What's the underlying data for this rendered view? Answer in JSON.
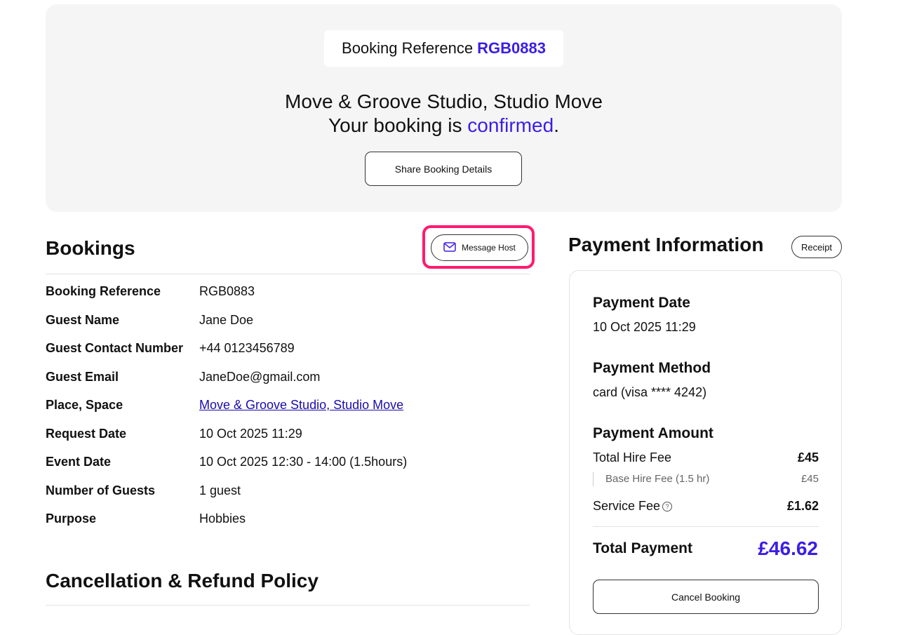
{
  "hero": {
    "ref_label": "Booking Reference",
    "ref_code": "RGB0883",
    "title": "Move & Groove Studio, Studio Move",
    "status_prefix": "Your booking is",
    "status_word": "confirmed",
    "status_suffix": ".",
    "share_label": "Share Booking Details"
  },
  "bookings": {
    "title": "Bookings",
    "message_host_label": "Message Host",
    "rows": [
      {
        "label": "Booking Reference",
        "value": "RGB0883"
      },
      {
        "label": "Guest Name",
        "value": "Jane Doe"
      },
      {
        "label": "Guest Contact Number",
        "value": "+44 0123456789"
      },
      {
        "label": "Guest Email",
        "value": "JaneDoe@gmail.com"
      },
      {
        "label": "Place, Space",
        "value": "Move & Groove Studio, Studio Move"
      },
      {
        "label": "Request Date",
        "value": "10 Oct 2025 11:29"
      },
      {
        "label": "Event Date",
        "value": "10 Oct 2025 12:30 - 14:00 (1.5hours)"
      },
      {
        "label": "Number of Guests",
        "value": "1 guest"
      },
      {
        "label": "Purpose",
        "value": "Hobbies"
      }
    ]
  },
  "policy": {
    "title": "Cancellation & Refund Policy"
  },
  "payment": {
    "title": "Payment Information",
    "receipt_label": "Receipt",
    "date_label": "Payment Date",
    "date_value": "10 Oct 2025 11:29",
    "method_label": "Payment Method",
    "method_value": "card (visa **** 4242)",
    "amount_label": "Payment Amount",
    "total_hire_label": "Total Hire Fee",
    "total_hire_value": "£45",
    "base_hire_label": "Base Hire Fee (1.5 hr)",
    "base_hire_value": "£45",
    "service_fee_label": "Service Fee",
    "service_fee_value": "£1.62",
    "total_label": "Total Payment",
    "total_value": "£46.62",
    "cancel_label": "Cancel Booking"
  },
  "colors": {
    "accent": "#3b1ee6",
    "highlight": "#ff1a6e",
    "link": "#1a0dab"
  }
}
